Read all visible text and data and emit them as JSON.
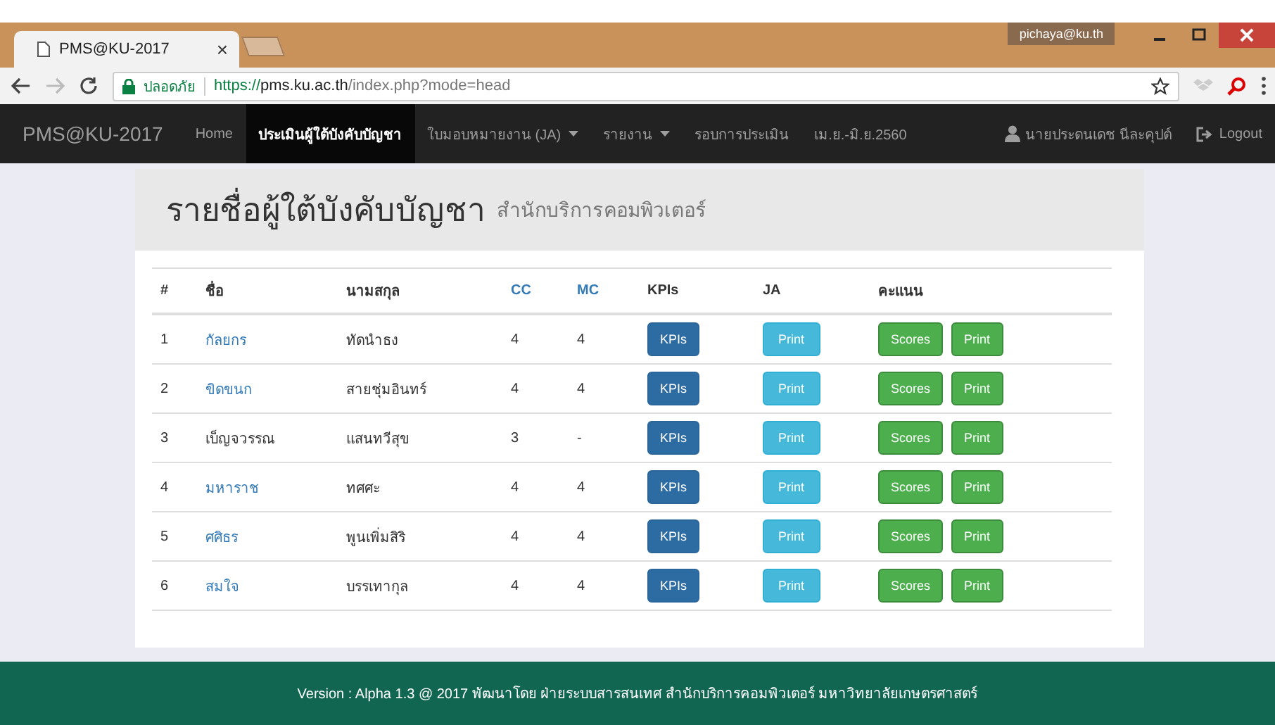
{
  "browser": {
    "tab_title": "PMS@KU-2017",
    "tab_close": "×",
    "profile": "pichaya@ku.th",
    "security_label": "ปลอดภัย",
    "url": {
      "scheme": "https://",
      "host": "pms.ku.ac.th",
      "path": "/index.php?mode=head"
    }
  },
  "navbar": {
    "brand": "PMS@KU-2017",
    "items": [
      {
        "label": "Home",
        "selected": false,
        "dropdown": false
      },
      {
        "label": "ประเมินผู้ใต้บังคับบัญชา",
        "selected": true,
        "dropdown": false
      },
      {
        "label": "ใบมอบหมายงาน (JA)",
        "selected": false,
        "dropdown": true
      },
      {
        "label": "รายงาน",
        "selected": false,
        "dropdown": true
      },
      {
        "label": "รอบการประเมิน",
        "selected": false,
        "dropdown": false
      },
      {
        "label": "เม.ย.-มิ.ย.2560",
        "selected": false,
        "dropdown": false
      }
    ],
    "user": "นายประดนเดช นีละคุปต์",
    "logout": "Logout"
  },
  "page": {
    "title": "รายชื่อผู้ใต้บังคับบัญชา",
    "subtitle": "สำนักบริการคอมพิวเตอร์"
  },
  "table": {
    "columns": [
      {
        "label": "#",
        "link": false
      },
      {
        "label": "ชื่อ",
        "link": false
      },
      {
        "label": "นามสกุล",
        "link": false
      },
      {
        "label": "CC",
        "link": true
      },
      {
        "label": "MC",
        "link": true
      },
      {
        "label": "KPIs",
        "link": false
      },
      {
        "label": "JA",
        "link": false
      },
      {
        "label": "คะแนน",
        "link": false
      }
    ],
    "rows": [
      {
        "no": "1",
        "first": "กัลยกร",
        "link": true,
        "last": "ทัดนำธง",
        "cc": "4",
        "mc": "4",
        "kpi": "KPIs",
        "ja": "Print",
        "scores": "Scores",
        "print": "Print"
      },
      {
        "no": "2",
        "first": "ขิดขนก",
        "link": true,
        "last": "สายชุ่มอินทร์",
        "cc": "4",
        "mc": "4",
        "kpi": "KPIs",
        "ja": "Print",
        "scores": "Scores",
        "print": "Print"
      },
      {
        "no": "3",
        "first": "เบ็ญจวรรณ",
        "link": false,
        "last": "แสนทวีสุข",
        "cc": "3",
        "mc": "-",
        "kpi": "KPIs",
        "ja": "Print",
        "scores": "Scores",
        "print": "Print"
      },
      {
        "no": "4",
        "first": "มหาราช",
        "link": true,
        "last": "ทศศะ",
        "cc": "4",
        "mc": "4",
        "kpi": "KPIs",
        "ja": "Print",
        "scores": "Scores",
        "print": "Print"
      },
      {
        "no": "5",
        "first": "ศศิธร",
        "link": true,
        "last": "พูนเพิ่มสิริ",
        "cc": "4",
        "mc": "4",
        "kpi": "KPIs",
        "ja": "Print",
        "scores": "Scores",
        "print": "Print"
      },
      {
        "no": "6",
        "first": "สมใจ",
        "link": true,
        "last": "บรรเทากุล",
        "cc": "4",
        "mc": "4",
        "kpi": "KPIs",
        "ja": "Print",
        "scores": "Scores",
        "print": "Print"
      }
    ]
  },
  "footer": "Version : Alpha 1.3 @ 2017 พัฒนาโดย ฝ่ายระบบสารสนเทศ สำนักบริการคอมพิวเตอร์ มหาวิทยาลัยเกษตรศาสตร์"
}
